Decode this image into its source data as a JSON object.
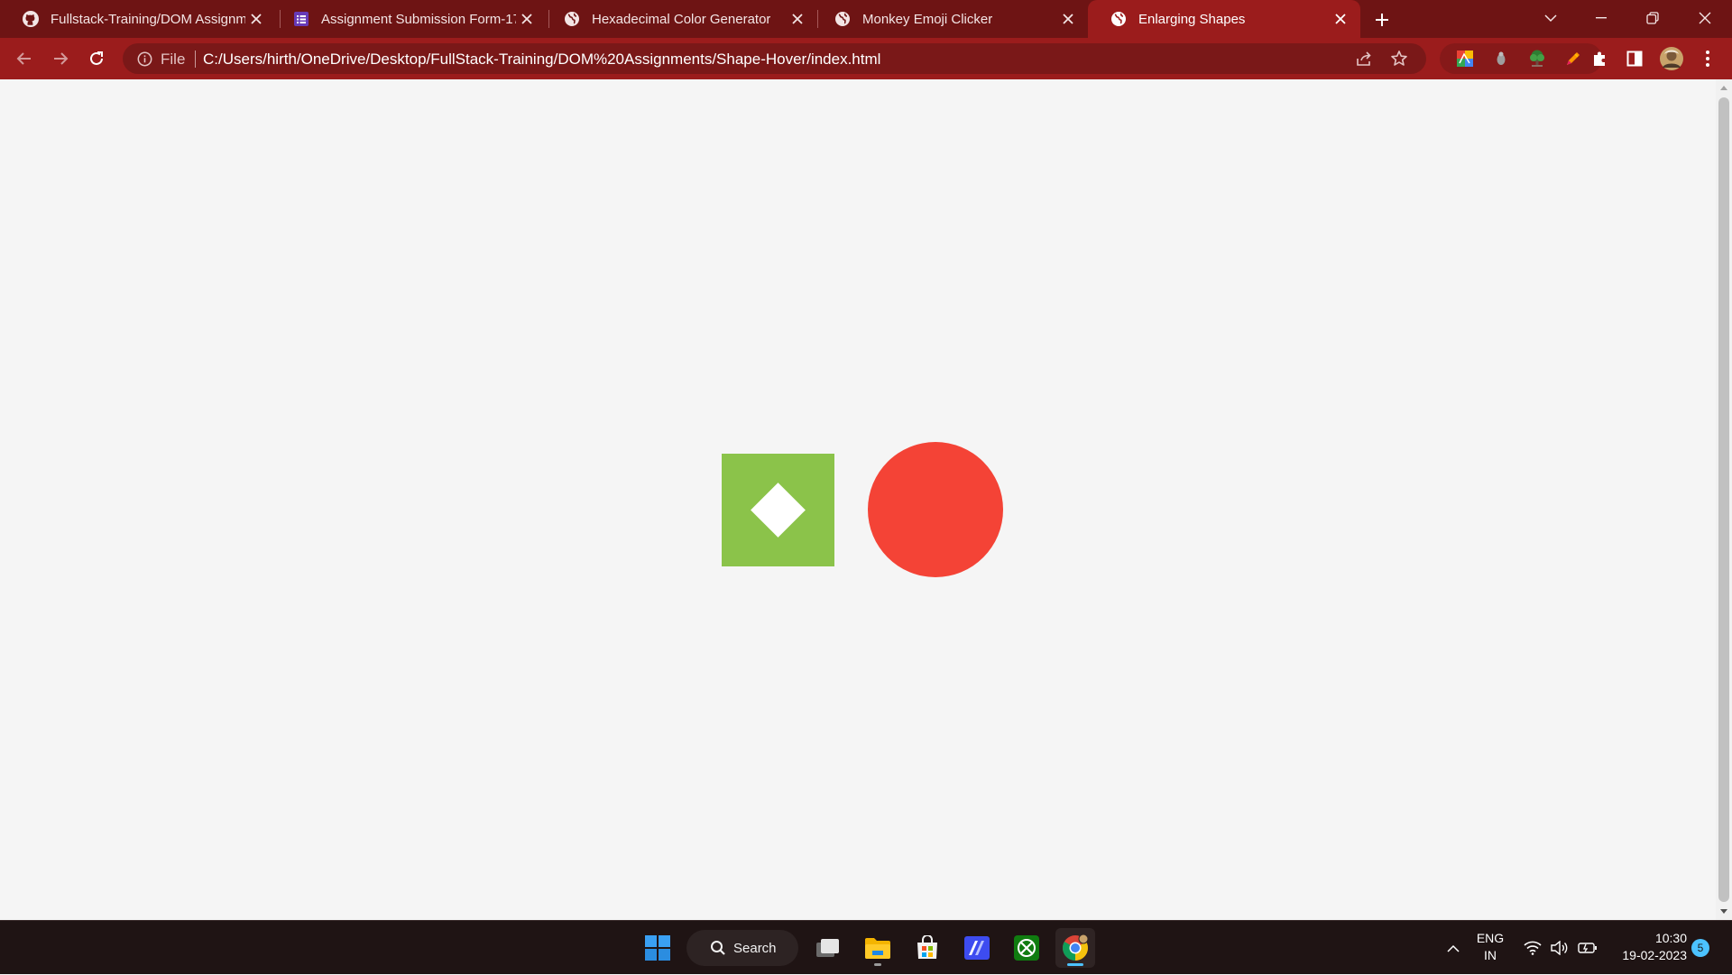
{
  "browser": {
    "tabs": [
      {
        "title": "Fullstack-Training/DOM Assignm",
        "icon": "github-icon",
        "active": false
      },
      {
        "title": "Assignment Submission Form-17",
        "icon": "forms-icon",
        "active": false
      },
      {
        "title": "Hexadecimal Color Generator",
        "icon": "globe-icon",
        "active": false
      },
      {
        "title": "Monkey Emoji Clicker",
        "icon": "globe-icon",
        "active": false
      },
      {
        "title": "Enlarging Shapes",
        "icon": "globe-icon",
        "active": true
      }
    ],
    "address_bar": {
      "scheme_label": "File",
      "url": "C:/Users/hirth/OneDrive/Desktop/FullStack-Training/DOM%20Assignments/Shape-Hover/index.html"
    },
    "theme_colors": {
      "tabstrip": "#6e1414",
      "toolbar": "#9b1c1c"
    }
  },
  "page": {
    "shapes": [
      {
        "kind": "square",
        "color": "#8bc34a",
        "inner": "white diamond"
      },
      {
        "kind": "circle",
        "color": "#f44336"
      }
    ],
    "background": "#f5f5f5"
  },
  "taskbar": {
    "search_label": "Search",
    "language": {
      "line1": "ENG",
      "line2": "IN"
    },
    "clock": {
      "time": "10:30",
      "date": "19-02-2023"
    },
    "notification_count": "5",
    "apps": [
      "start-icon",
      "search-icon",
      "task-view-icon",
      "file-explorer-icon",
      "microsoft-store-icon",
      "app-icon",
      "xbox-icon",
      "chrome-icon"
    ]
  }
}
